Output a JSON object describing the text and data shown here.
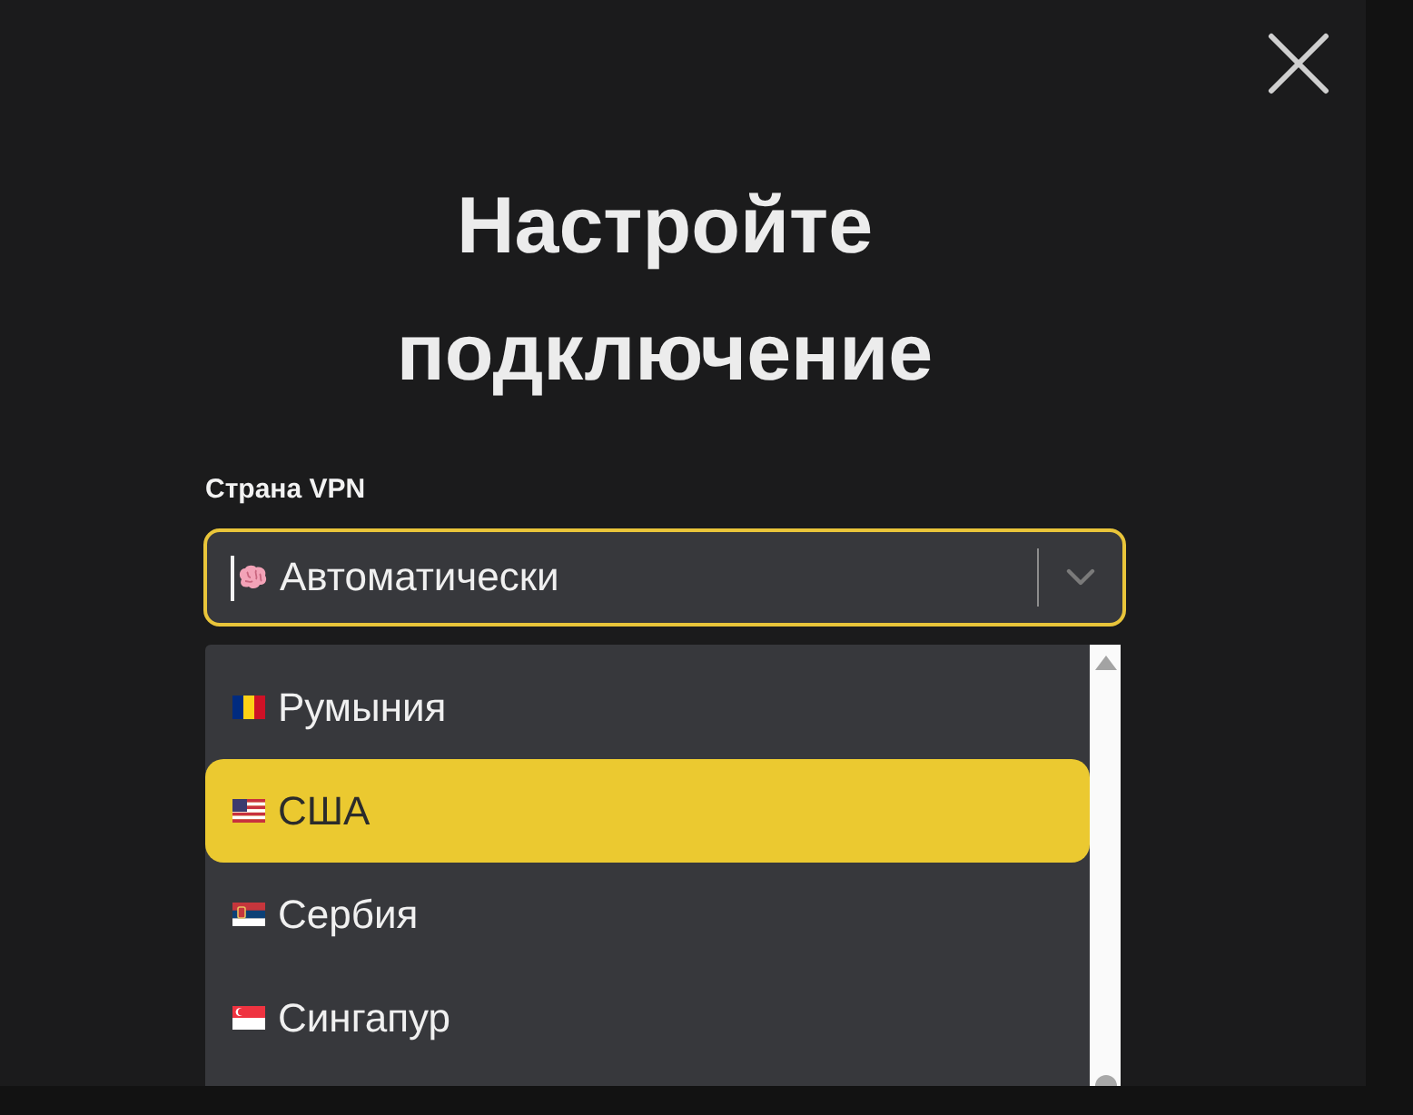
{
  "dialog": {
    "title": "Настройте подключение"
  },
  "country_select": {
    "label": "Страна VPN",
    "value": "Автоматически",
    "focused": true,
    "expanded": true
  },
  "options": [
    {
      "label": "Румыния",
      "kind": "romania",
      "selected": false
    },
    {
      "label": "США",
      "kind": "usa",
      "selected": true
    },
    {
      "label": "Сербия",
      "kind": "serbia",
      "selected": false
    },
    {
      "label": "Сингапур",
      "kind": "singapore",
      "selected": false
    }
  ]
}
